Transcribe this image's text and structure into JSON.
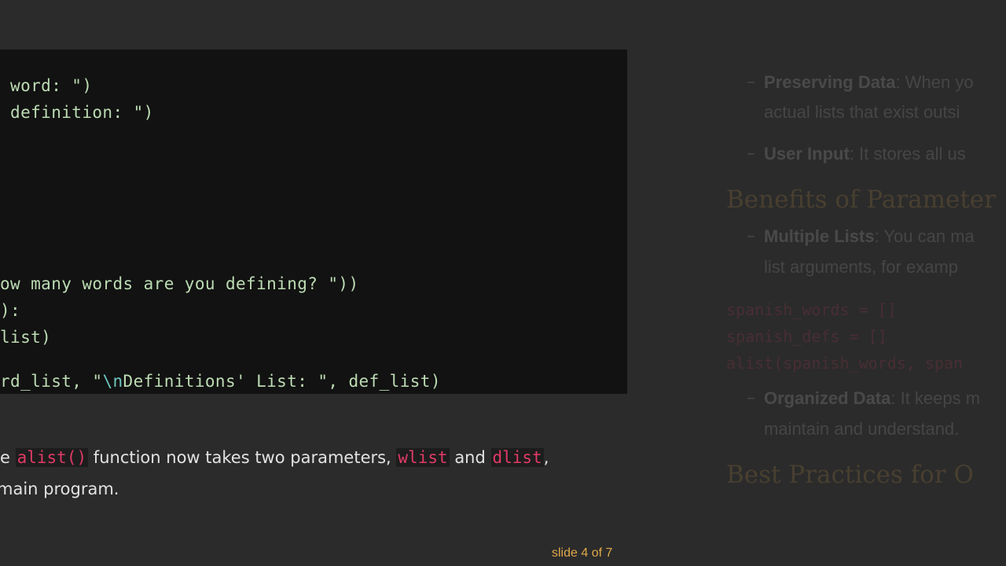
{
  "code": {
    "lines": [
      {
        "segments": [
          {
            "t": " word: \")",
            "c": "str"
          }
        ]
      },
      {
        "segments": [
          {
            "t": " definition: \")",
            "c": "str"
          }
        ]
      },
      {
        "segments": [
          {
            "t": "ow many words are you defining? \"))",
            "c": "str"
          }
        ]
      },
      {
        "segments": [
          {
            "t": "):",
            "c": "str"
          }
        ]
      },
      {
        "segments": [
          {
            "t": "list)",
            "c": "str"
          }
        ]
      },
      {
        "segments": [
          {
            "t": "rd_list, \"",
            "c": "str"
          },
          {
            "t": "\\n",
            "c": "esc"
          },
          {
            "t": "Definitions' List: \", def_list)",
            "c": "str"
          }
        ]
      }
    ]
  },
  "paragraph": {
    "line1": {
      "prefix": "e ",
      "code1": "alist()",
      "mid": " function now takes two parameters, ",
      "code2": "wlist",
      "and": " and ",
      "code3": "dlist",
      "suffix": ","
    },
    "line2": "main program."
  },
  "slide_counter": "slide 4 of 7",
  "preview": {
    "bullet1": {
      "bold": "Preserving Data",
      "text": ": When yo",
      "cont": "actual lists that exist outsi"
    },
    "bullet2": {
      "bold": "User Input",
      "text": ": It stores all us"
    },
    "heading1": "Benefits of Parameter",
    "bullet3": {
      "bold": "Multiple Lists",
      "text": ": You can ma",
      "cont": "list arguments, for examp"
    },
    "code": [
      "spanish_words = []",
      "spanish_defs = []",
      "alist(spanish_words, span"
    ],
    "bullet4": {
      "bold": "Organized Data",
      "text": ": It keeps m",
      "cont": "maintain and understand."
    },
    "heading2": "Best Practices for O"
  },
  "colors": {
    "background": "#2b2b2b",
    "code_bg": "#121212",
    "code_string": "#bcdcb3",
    "inline_code": "#e03a66",
    "accent": "#e0a94a"
  }
}
